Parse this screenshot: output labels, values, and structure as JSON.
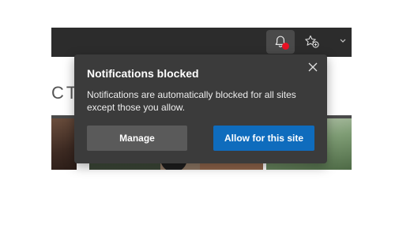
{
  "toolbar": {
    "icons": {
      "notifications": "bell-icon",
      "favorites": "star-plus-icon",
      "more": "chevron-icon"
    },
    "notification_alert_color": "#e81123"
  },
  "page": {
    "heading_fragment": "CTS"
  },
  "popup": {
    "title": "Notifications blocked",
    "message": "Notifications are automatically blocked for all sites except those you allow.",
    "close_icon": "close-icon",
    "manage_label": "Manage",
    "allow_label": "Allow for this site",
    "colors": {
      "background": "#3b3b3b",
      "primary_button": "#0f6cbd",
      "secondary_button": "#5a5a5a"
    }
  }
}
